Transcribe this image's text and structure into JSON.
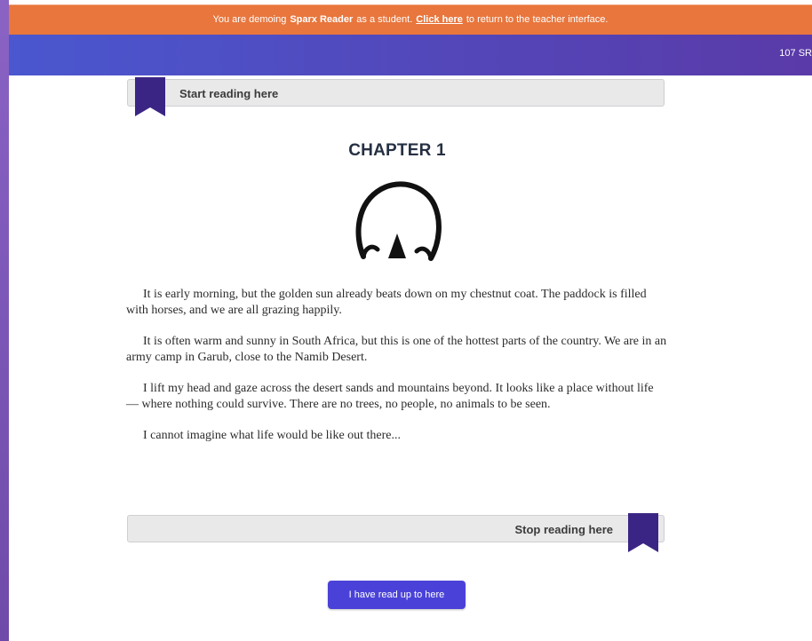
{
  "banner": {
    "prefix": "You are demoing",
    "app_name": "Sparx Reader",
    "middle": "as a student.",
    "link": "Click here",
    "suffix": "to return to the teacher interface."
  },
  "header": {
    "sr_points": "107 SR"
  },
  "reading": {
    "start_label": "Start reading here",
    "stop_label": "Stop reading here",
    "chapter_title": "CHAPTER 1",
    "paragraphs": [
      "It is early morning, but the golden sun already beats down on my chestnut coat. The paddock is filled with horses, and we are all grazing happily.",
      "It is often warm and sunny in South Africa, but this is one of the hottest parts of the country. We are in an army camp in Garub, close to the Namib Desert.",
      "I lift my head and gaze across the desert sands and mountains beyond. It looks like a place without life — where nothing could survive. There are no trees, no people, no animals to be seen.",
      "I cannot imagine what life would be like out there..."
    ],
    "confirm_button": "I have read up to here"
  },
  "colors": {
    "banner": "#e8763d",
    "topbar_start": "#4a57cf",
    "topbar_end": "#5a3aa8",
    "bookmark": "#3b2584",
    "button": "#4a42d8"
  },
  "icons": {
    "bookmark": "bookmark-icon",
    "emblem": "horseshoe-emblem-icon"
  }
}
